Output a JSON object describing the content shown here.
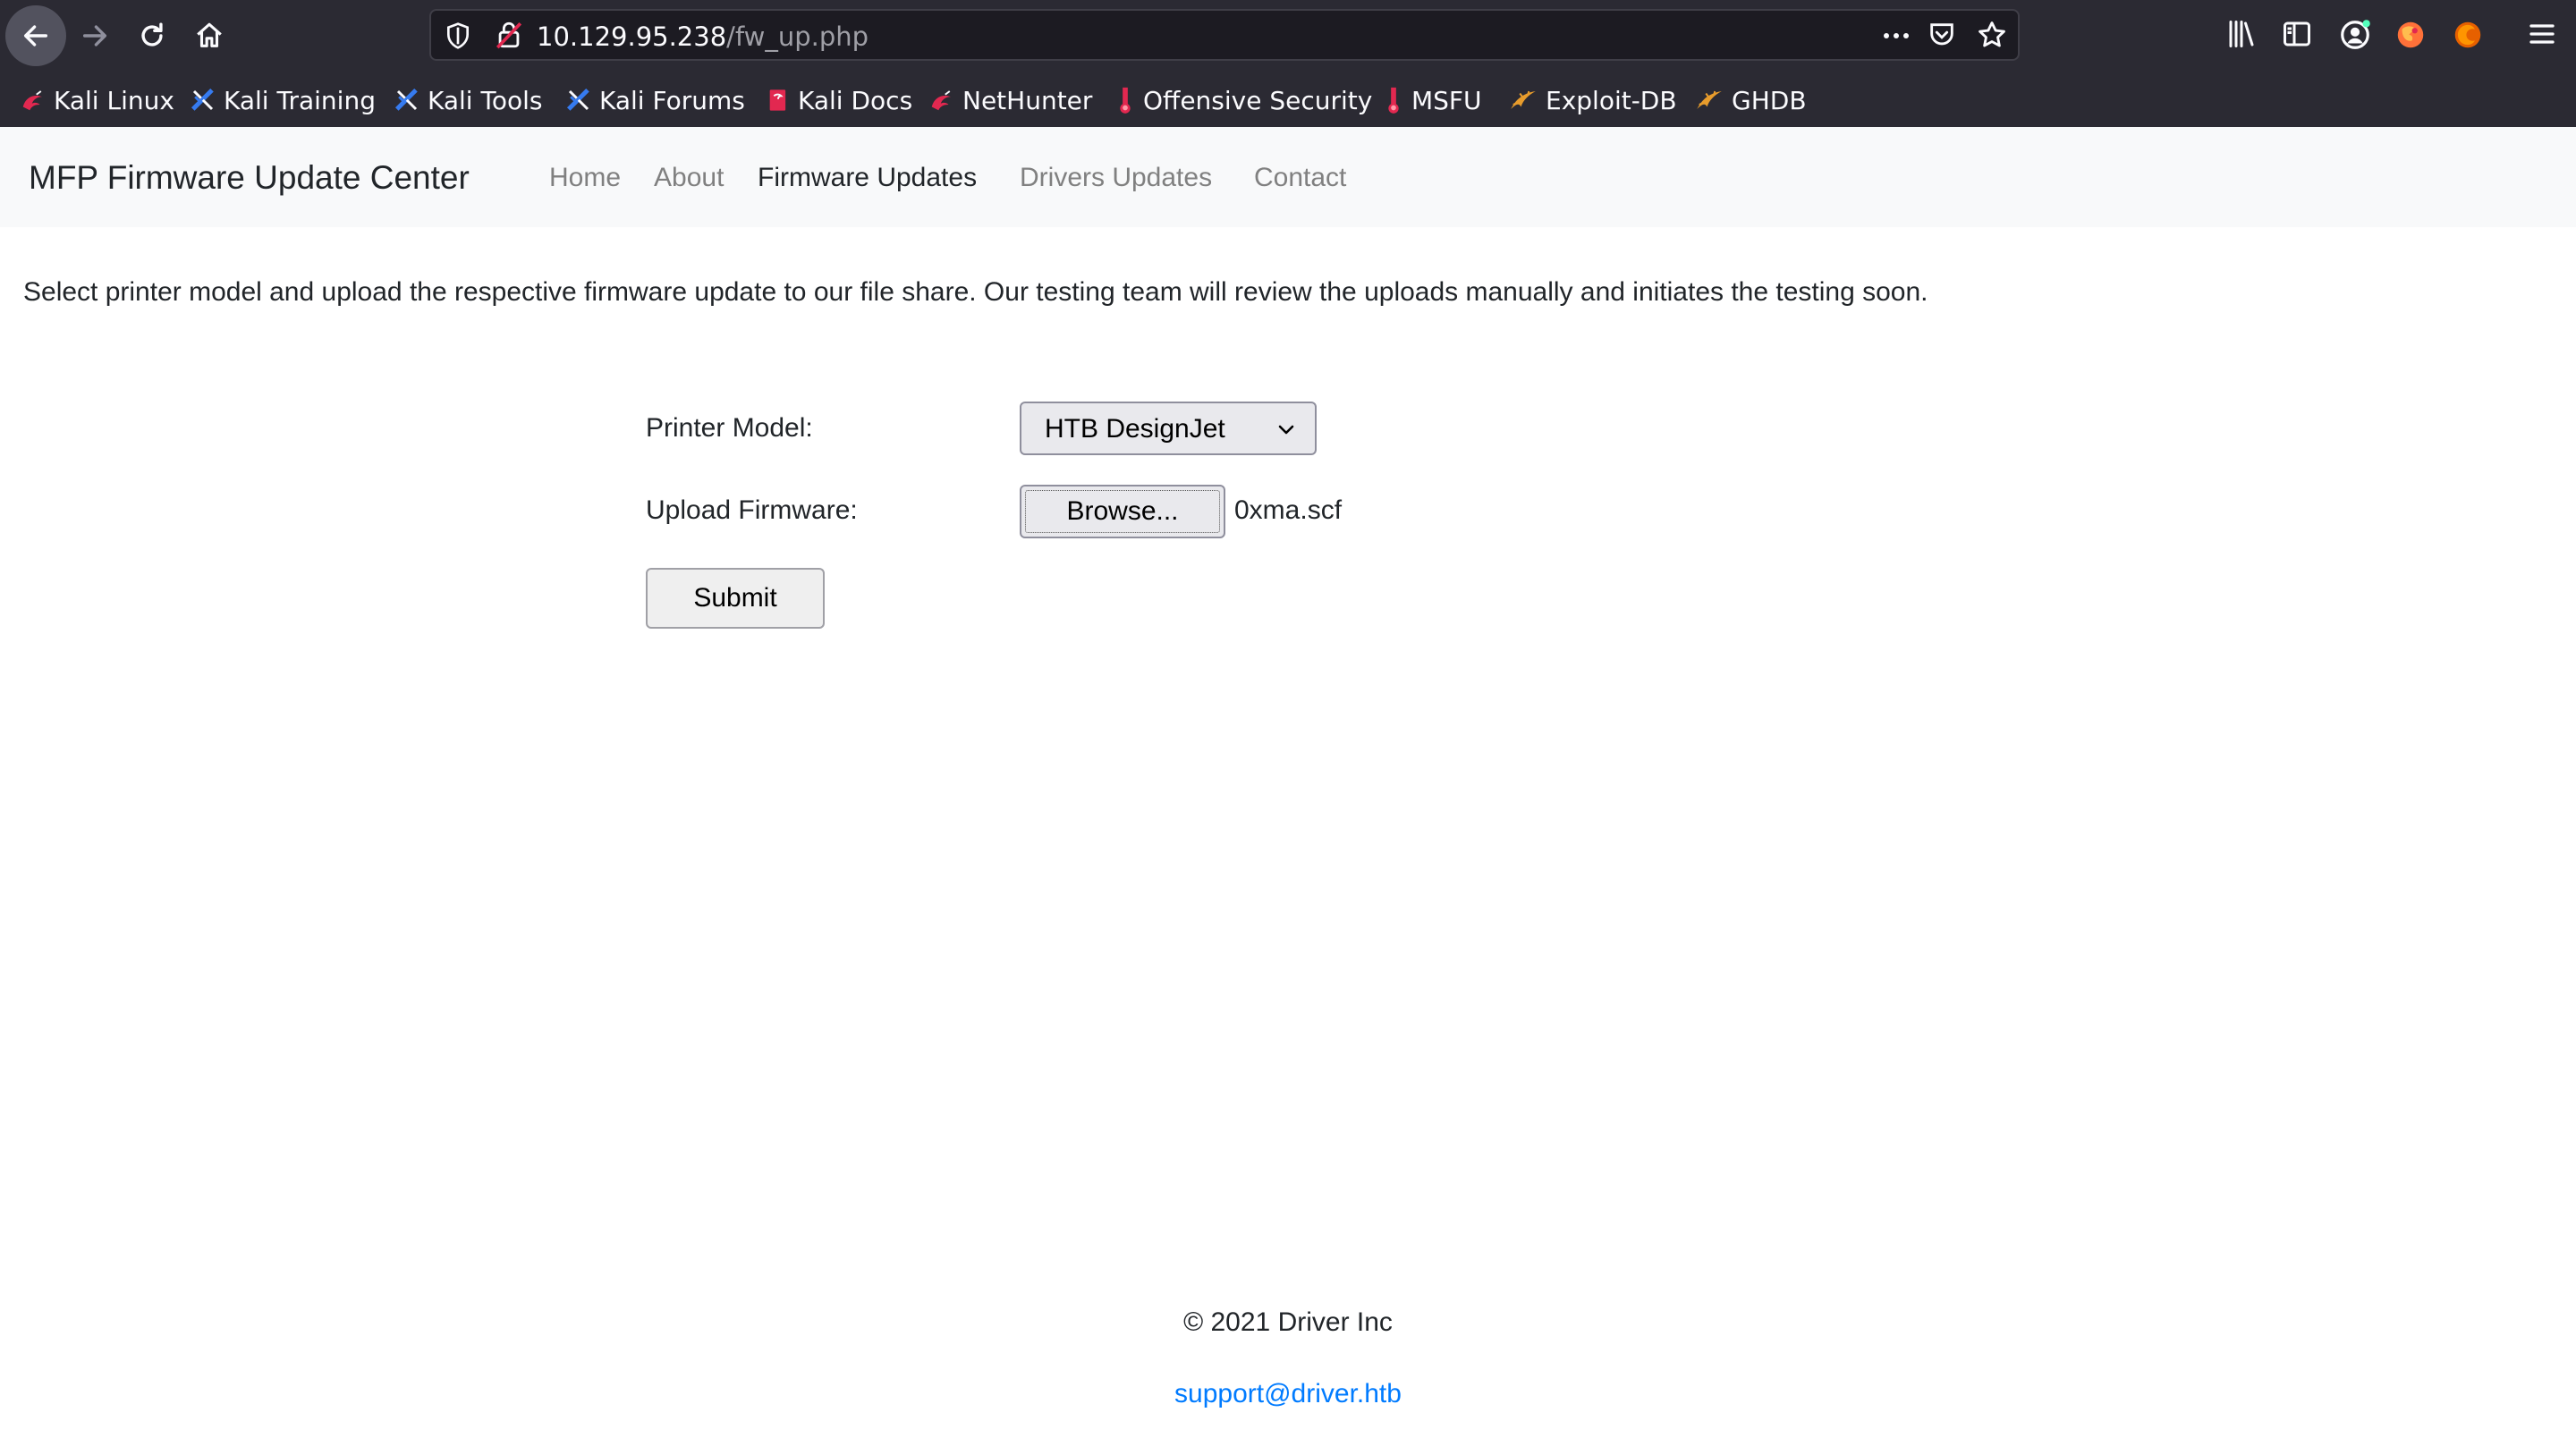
{
  "browser": {
    "url": {
      "host": "10.129.95.238",
      "path": "/fw_up.php"
    },
    "bookmarks": [
      {
        "label": "Kali Linux",
        "icon": "kali-dragon-icon"
      },
      {
        "label": "Kali Training",
        "icon": "kali-training-icon"
      },
      {
        "label": "Kali Tools",
        "icon": "kali-tools-icon"
      },
      {
        "label": "Kali Forums",
        "icon": "kali-forums-icon"
      },
      {
        "label": "Kali Docs",
        "icon": "kali-docs-icon"
      },
      {
        "label": "NetHunter",
        "icon": "nethunter-icon"
      },
      {
        "label": "Offensive Security",
        "icon": "offsec-icon"
      },
      {
        "label": "MSFU",
        "icon": "msfu-icon"
      },
      {
        "label": "Exploit-DB",
        "icon": "exploitdb-icon"
      },
      {
        "label": "GHDB",
        "icon": "ghdb-icon"
      }
    ]
  },
  "site": {
    "brand": "MFP Firmware Update Center",
    "nav": [
      {
        "label": "Home",
        "active": false
      },
      {
        "label": "About",
        "active": false
      },
      {
        "label": "Firmware Updates",
        "active": true
      },
      {
        "label": "Drivers Updates",
        "active": false
      },
      {
        "label": "Contact",
        "active": false
      }
    ],
    "intro": "Select printer model and upload the respective firmware update to our file share. Our testing team will review the uploads manually and initiates the testing soon.",
    "form": {
      "printer_model_label": "Printer Model:",
      "printer_model_value": "HTB DesignJet",
      "upload_label": "Upload Firmware:",
      "browse_label": "Browse...",
      "file_name": "0xma.scf",
      "submit_label": "Submit"
    },
    "footer": {
      "copyright": "© 2021 Driver Inc",
      "email": "support@driver.htb"
    }
  },
  "colors": {
    "chrome_bg": "#2b2a33",
    "urlbar_bg": "#1c1b22",
    "navbar_bg": "#f8f9fa",
    "link_blue": "#007bff",
    "nav_muted": "#808080"
  }
}
